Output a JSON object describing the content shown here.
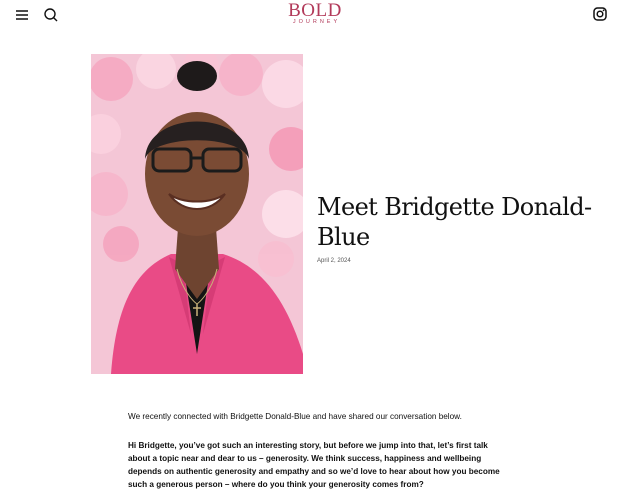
{
  "header": {
    "logo_line1": "BOLD",
    "logo_line2": "JOURNEY",
    "icons": [
      "menu-icon",
      "search-icon",
      "instagram-icon"
    ]
  },
  "colors": {
    "brand": "#b23a5a",
    "background": "#ffffff",
    "text": "#111111"
  },
  "article": {
    "title": "Meet Bridgette Donald-Blue",
    "date": "April 2, 2024",
    "intro": "We recently connected with Bridgette Donald-Blue and have shared our conversation below.",
    "question": "Hi Bridgette, you’ve got such an interesting story, but before we jump into that, let’s first talk about a topic near and dear to us – generosity. We think success, happiness and wellbeing depends on authentic generosity and empathy and so we’d love to hear about how you become such a generous person – where do you think your generosity comes from?"
  }
}
